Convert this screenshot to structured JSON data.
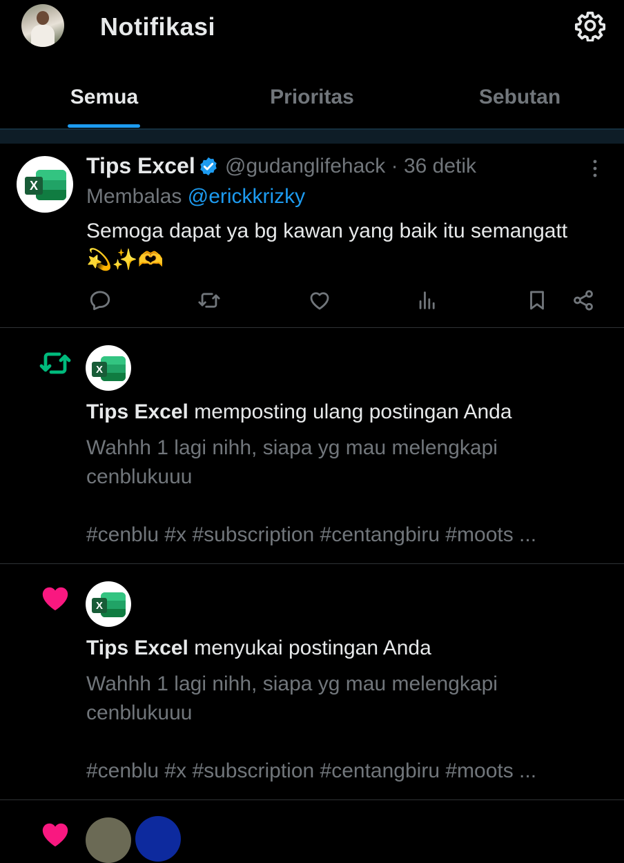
{
  "header": {
    "title": "Notifikasi",
    "avatar_icon": "profile-avatar",
    "settings_icon": "gear-icon"
  },
  "tabs": [
    {
      "label": "Semua",
      "active": true
    },
    {
      "label": "Prioritas",
      "active": false
    },
    {
      "label": "Sebutan",
      "active": false
    }
  ],
  "reply_post": {
    "author": "Tips Excel",
    "handle": "@gudanglifehack",
    "separator": "·",
    "time": "36 detik",
    "replying_prefix": "Membalas",
    "replying_to": "@erickkrizky",
    "text": "Semoga dapat ya bg kawan yang baik itu semangatt",
    "emojis": "💫✨🫶",
    "actions": [
      "reply-icon",
      "repost-icon",
      "like-icon",
      "views-icon",
      "bookmark-icon",
      "share-icon"
    ]
  },
  "notifications": [
    {
      "type_icon": "repost-icon",
      "author": "Tips Excel",
      "action_text": "memposting ulang postingan Anda",
      "preview_line1": "Wahhh 1 lagi nihh, siapa yg mau melengkapi",
      "preview_line2": "cenblukuuu",
      "preview_tags": "#cenblu #x #subscription #centangbiru #moots ..."
    },
    {
      "type_icon": "heart-icon",
      "author": "Tips Excel",
      "action_text": "menyukai postingan Anda",
      "preview_line1": "Wahhh 1 lagi nihh, siapa yg mau melengkapi",
      "preview_line2": "cenblukuuu",
      "preview_tags": "#cenblu #x #subscription #centangbiru #moots ..."
    }
  ],
  "colors": {
    "accent": "#1d9bf0",
    "repost": "#00ba7c",
    "like": "#f91880",
    "muted": "#71767b",
    "background": "#000000"
  },
  "logo_letter": "X"
}
